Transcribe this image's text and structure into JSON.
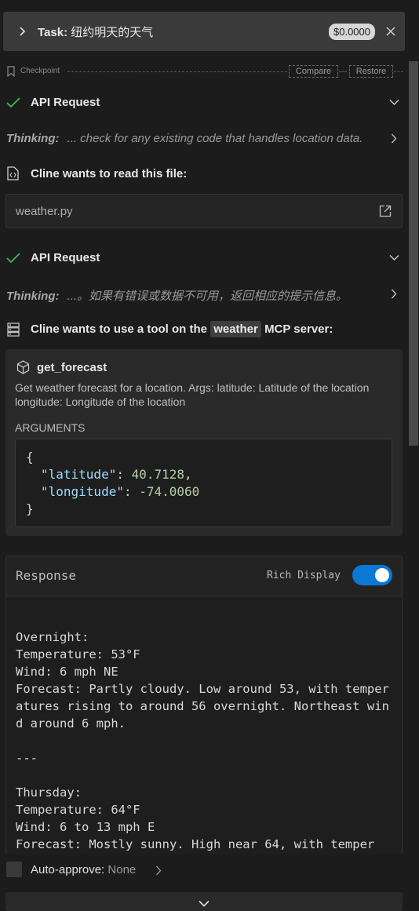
{
  "task": {
    "label": "Task:",
    "title": "纽约明天的天气",
    "cost": "$0.0000"
  },
  "checkpoint": {
    "label": "Checkpoint",
    "compare": "Compare",
    "restore": "Restore"
  },
  "api_request_1": {
    "label": "API Request"
  },
  "thinking_1": {
    "label": "Thinking:",
    "text": "... check for any existing code that handles location data."
  },
  "read_file": {
    "label": "Cline wants to read this file:",
    "filename": "weather.py"
  },
  "api_request_2": {
    "label": "API Request"
  },
  "thinking_2": {
    "label": "Thinking:",
    "text": "...。如果有错误或数据不可用，返回相应的提示信息。"
  },
  "mcp": {
    "prefix": "Cline wants to use a tool on the",
    "server": "weather",
    "suffix": "MCP server:"
  },
  "tool": {
    "name": "get_forecast",
    "description": "Get weather forecast for a location. Args: latitude: Latitude of the location longitude: Longitude of the location",
    "arguments_label": "ARGUMENTS",
    "args": {
      "open": "{",
      "latitude_key": "\"latitude\"",
      "latitude_value": "40.7128",
      "longitude_key": "\"longitude\"",
      "longitude_value": "-74.0060",
      "close": "}"
    }
  },
  "response": {
    "label": "Response",
    "rich_display_label": "Rich Display",
    "rich_display_on": true,
    "body": "Overnight:\nTemperature: 53°F\nWind: 6 mph NE\nForecast: Partly cloudy. Low around 53, with temperatures rising to around 56 overnight. Northeast wind around 6 mph.\n\n---\n\nThursday:\nTemperature: 64°F\nWind: 6 to 13 mph E\nForecast: Mostly sunny. High near 64, with temper"
  },
  "auto_approve": {
    "label": "Auto-approve:",
    "value": "None"
  },
  "colors": {
    "accent": "#0a78d4",
    "check_green": "#3fb950"
  }
}
